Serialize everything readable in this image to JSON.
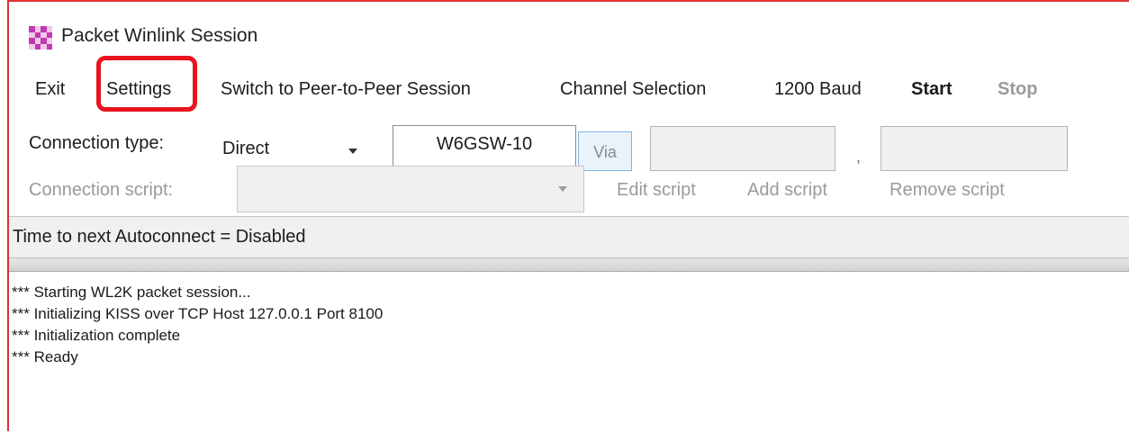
{
  "window": {
    "title": "Packet Winlink Session"
  },
  "menu": {
    "exit": "Exit",
    "settings": "Settings",
    "switch_session": "Switch to Peer-to-Peer Session",
    "channel_selection": "Channel Selection",
    "baud": "1200 Baud",
    "start": "Start",
    "stop": "Stop"
  },
  "connection": {
    "type_label": "Connection type:",
    "type_value": "Direct",
    "callsign": "W6GSW-10",
    "via_label": "Via",
    "via_value": "",
    "comma": ",",
    "extra_value": ""
  },
  "script": {
    "label": "Connection script:",
    "value": "",
    "edit": "Edit script",
    "add": "Add script",
    "remove": "Remove script"
  },
  "status": {
    "autoconnect": "Time to next Autoconnect = Disabled"
  },
  "log": {
    "lines": [
      "*** Starting WL2K packet session...",
      "*** Initializing KISS over TCP Host 127.0.0.1 Port 8100",
      "*** Initialization complete",
      "*** Ready"
    ]
  },
  "annotation": {
    "highlight_color": "#e8141e"
  }
}
